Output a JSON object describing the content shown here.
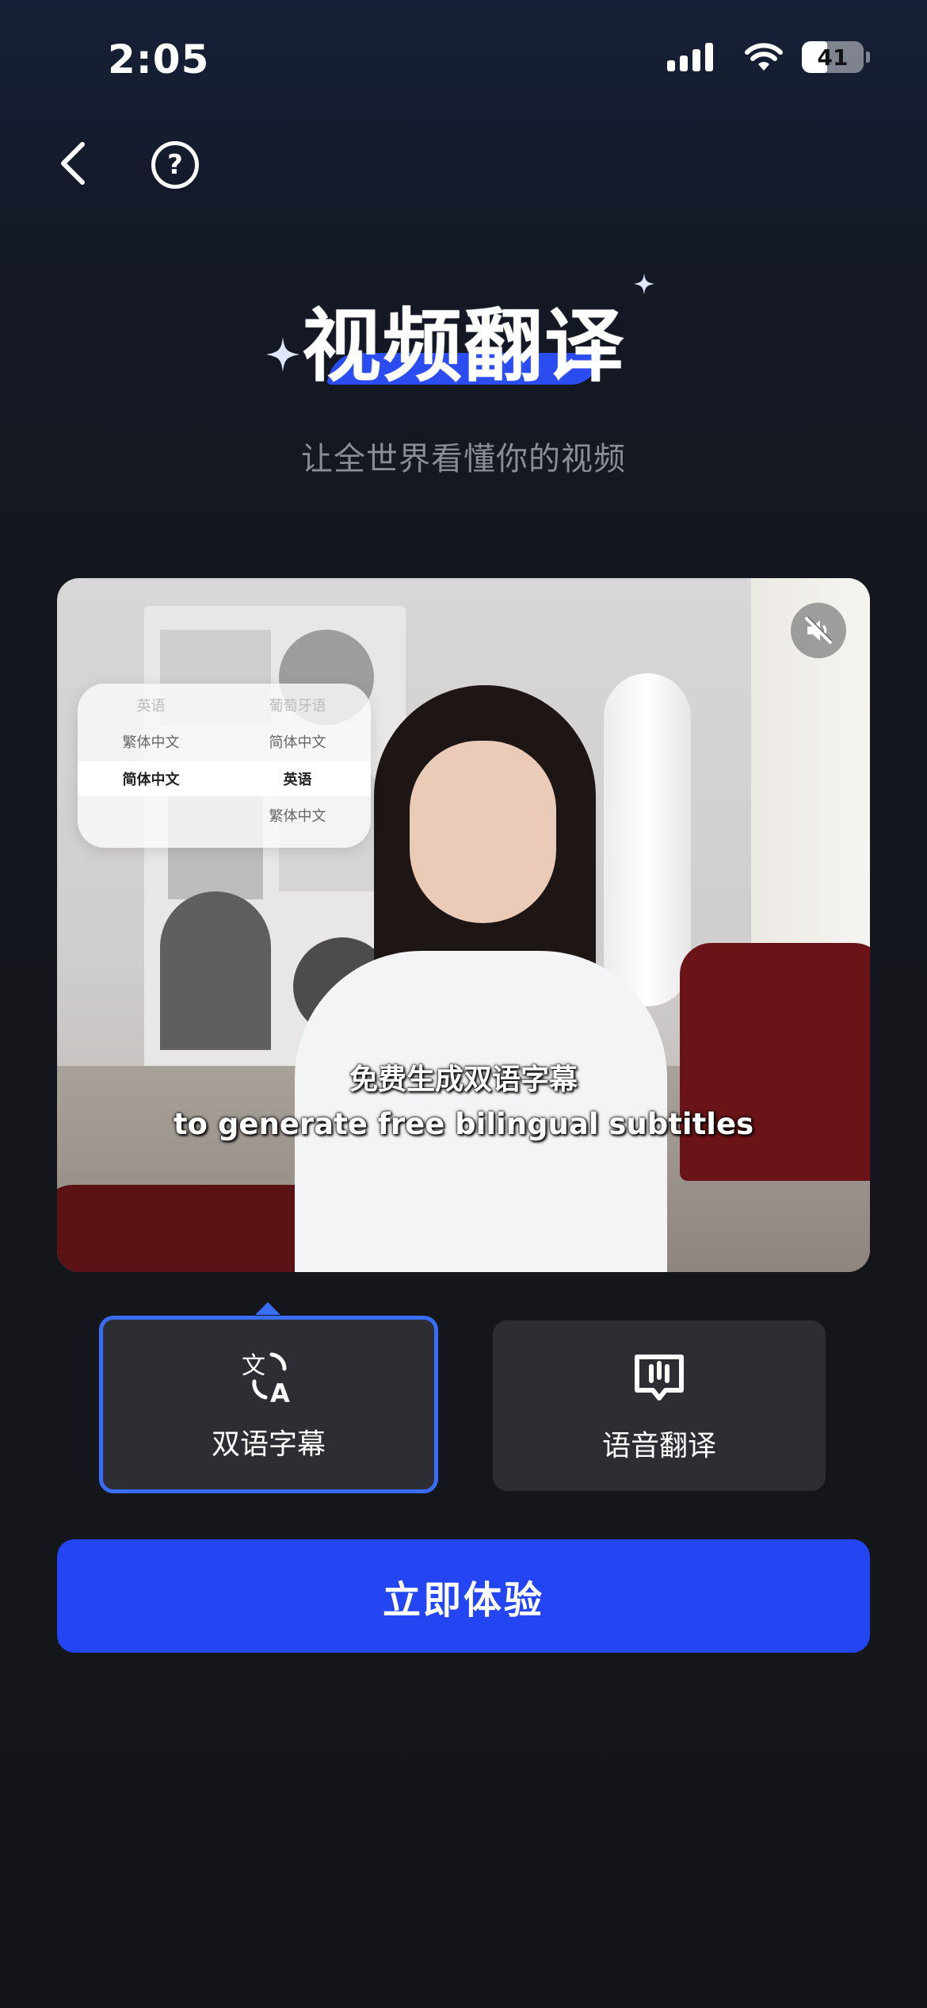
{
  "status_bar": {
    "time": "2:05",
    "battery": "41"
  },
  "nav": {
    "back_icon": "chevron-left-icon",
    "help_label": "?"
  },
  "hero": {
    "title": "视频翻译",
    "subtitle": "让全世界看懂你的视频"
  },
  "video": {
    "language_panel": {
      "rows": [
        [
          "英语",
          "葡萄牙语"
        ],
        [
          "繁体中文",
          "简体中文"
        ],
        [
          "简体中文",
          "英语"
        ],
        [
          "",
          "繁体中文"
        ]
      ]
    },
    "caption_cn": "免费生成双语字幕",
    "caption_en": "to generate free bilingual subtitles",
    "mute_icon": "speaker-muted-icon"
  },
  "modes": [
    {
      "label": "双语字幕",
      "icon": "translate-icon",
      "selected": true
    },
    {
      "label": "语音翻译",
      "icon": "voice-message-icon",
      "selected": false
    }
  ],
  "cta": {
    "label": "立即体验"
  },
  "colors": {
    "accent": "#2446F2",
    "selection_border": "#3A6DF5",
    "background": "#141519"
  }
}
